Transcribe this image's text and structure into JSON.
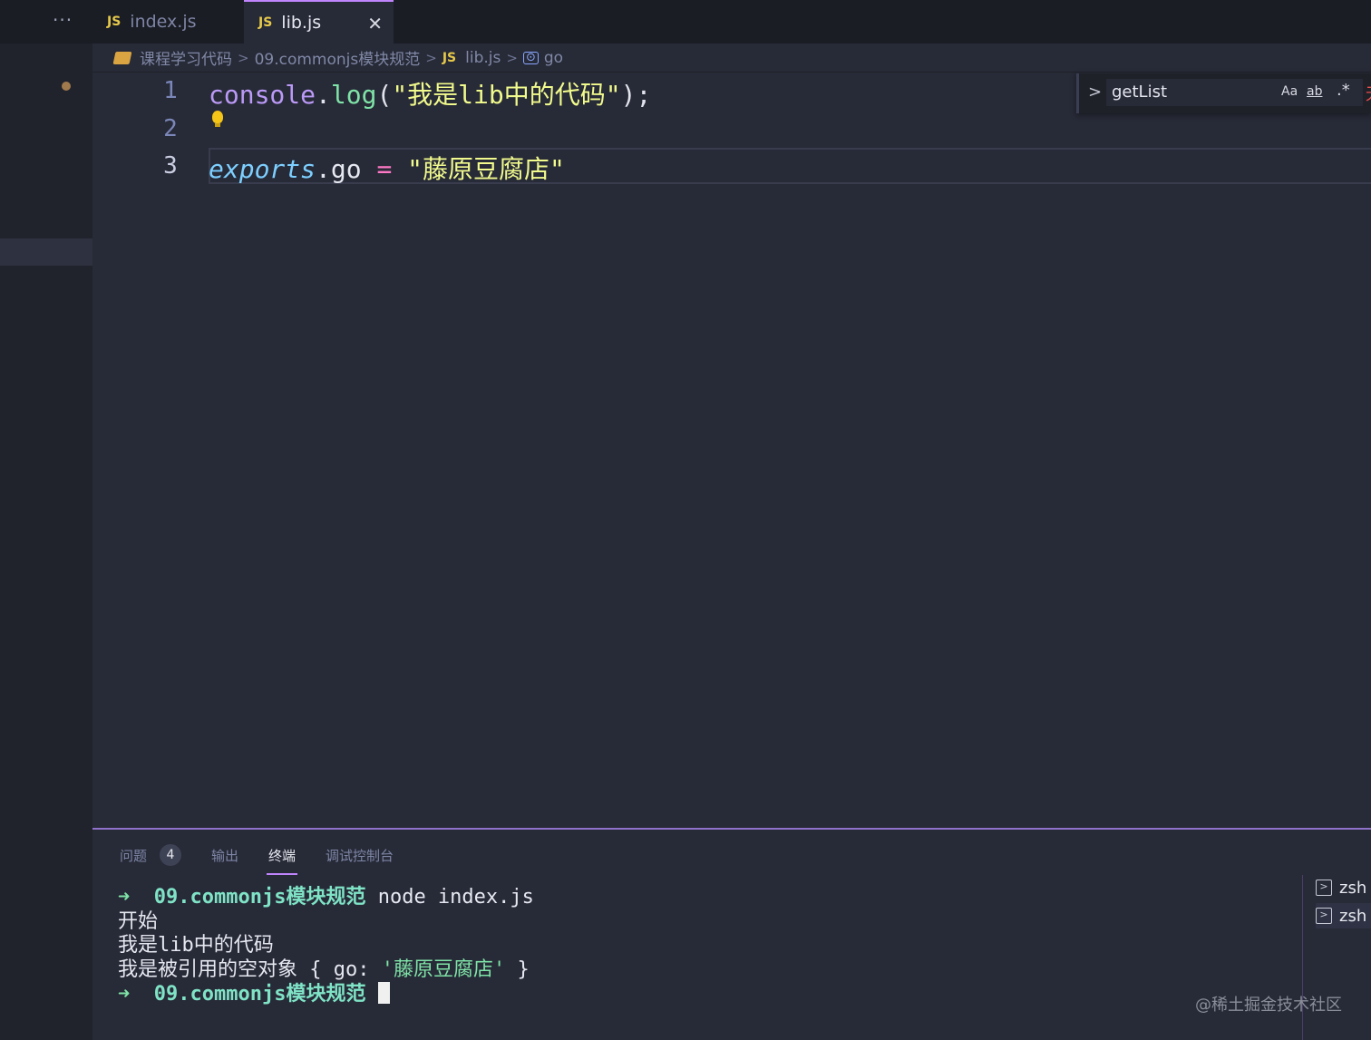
{
  "tabs": {
    "more": "···",
    "index": {
      "badge": "JS",
      "label": "index.js"
    },
    "lib": {
      "badge": "JS",
      "label": "lib.js",
      "close": "✕"
    }
  },
  "breadcrumb": {
    "folder": "课程学习代码",
    "subfolder": "09.commonjs模块规范",
    "file_badge": "JS",
    "file": "lib.js",
    "symbol": "go",
    "separator": ">"
  },
  "editor": {
    "lines": [
      "1",
      "2",
      "3"
    ],
    "line1": {
      "obj": "console",
      "dot": ".",
      "fn": "log",
      "open": "(",
      "str": "\"我是lib中的代码\"",
      "close": ");"
    },
    "line3": {
      "obj": "exports",
      "dot": ".",
      "prop": "go",
      "op": " = ",
      "str": "\"藤原豆腐店\""
    }
  },
  "find": {
    "chevron": ">",
    "value": "getList",
    "match_case": "Aa",
    "whole_word": "ab",
    "regex": ".*",
    "result": "无"
  },
  "panel": {
    "tabs": [
      {
        "label": "问题",
        "badge": "4"
      },
      {
        "label": "输出"
      },
      {
        "label": "终端"
      },
      {
        "label": "调试控制台"
      }
    ],
    "terminal": {
      "prompt_arrow": "➜",
      "dir": "09.commonjs模块规范",
      "command": "node index.js",
      "out1": "开始",
      "out2": "我是lib中的代码",
      "out3_prefix": "我是被引用的空对象 { go: ",
      "out3_str": "'藤原豆腐店'",
      "out3_suffix": " }"
    },
    "shells": [
      "zsh",
      "zsh"
    ]
  },
  "watermark": "@稀土掘金技术社区",
  "colors": {
    "accent": "#c084fc",
    "string": "#f1fa8c",
    "function": "#7fe3a7",
    "keyword": "#bb9af7",
    "background": "#272a37"
  }
}
